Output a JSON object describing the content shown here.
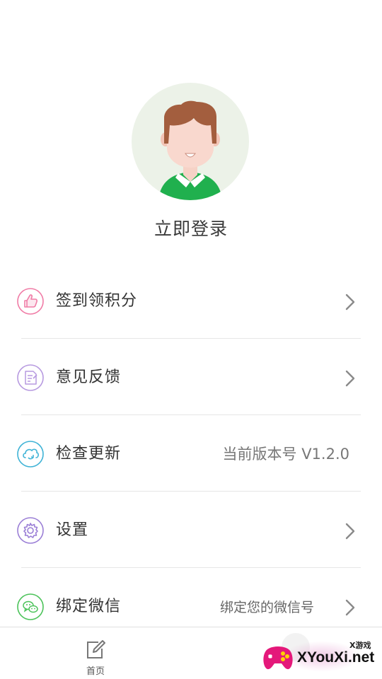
{
  "profile": {
    "login_label": "立即登录"
  },
  "menu": {
    "items": [
      {
        "label": "签到领积分",
        "value": "",
        "icon": "thumbs-up-icon",
        "icon_color": "#f07ca6",
        "has_arrow": true
      },
      {
        "label": "意见反馈",
        "value": "",
        "icon": "feedback-document-icon",
        "icon_color": "#b79ae0",
        "has_arrow": true
      },
      {
        "label": "检查更新",
        "value": "当前版本号 V1.2.0",
        "icon": "cloud-refresh-icon",
        "icon_color": "#3fb3d6",
        "has_arrow": false
      },
      {
        "label": "设置",
        "value": "",
        "icon": "gear-icon",
        "icon_color": "#9b7fd6",
        "has_arrow": true
      },
      {
        "label": "绑定微信",
        "value": "绑定您的微信号",
        "icon": "wechat-icon",
        "icon_color": "#4cc35a",
        "has_arrow": true
      }
    ]
  },
  "tabbar": {
    "home_label": "首页",
    "home_icon": "edit-icon"
  },
  "watermark": {
    "small": "X游戏",
    "big": "XYouXi.net"
  },
  "colors": {
    "avatar_bg": "#ecf2e8",
    "shirt_green": "#20b04e",
    "divider": "#e6e6e6"
  }
}
